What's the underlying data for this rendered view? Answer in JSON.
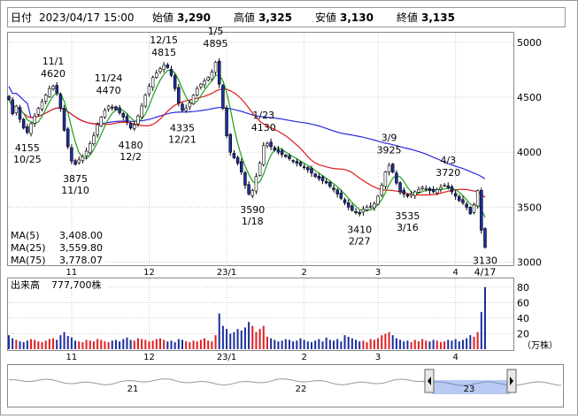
{
  "header": {
    "date_label": "日付",
    "date_value": "2023/04/17 15:00",
    "open_label": "始値",
    "open_value": "3,290",
    "high_label": "高値",
    "high_value": "3,325",
    "low_label": "安値",
    "low_value": "3,130",
    "close_label": "終値",
    "close_value": "3,135"
  },
  "colors": {
    "up": "#ffffff",
    "down": "#1c2fa0",
    "candle_edge": "#000000",
    "ma5": "#1e9e1e",
    "ma25": "#e01818",
    "ma75": "#2a2ae0",
    "high": "#e01818",
    "low": "#1e8e1e",
    "vol_up": "#e02020",
    "vol_down": "#1c2fa0",
    "navigator_fill": "#b0c4f0"
  },
  "chart_data": [
    {
      "type": "candlestick",
      "title": "",
      "y_ticks": [
        3000,
        3500,
        4000,
        4500,
        5000
      ],
      "x_ticks": [
        "11",
        "12",
        "23/1",
        "2",
        "3",
        "4"
      ],
      "ylim": [
        2980,
        5080
      ],
      "legend": [
        {
          "name": "MA(5)",
          "value": "3,408.00",
          "color_key": "ma5"
        },
        {
          "name": "MA(25)",
          "value": "3,559.80",
          "color_key": "ma25"
        },
        {
          "name": "MA(75)",
          "value": "3,778.07",
          "color_key": "ma75"
        }
      ],
      "annotations": [
        {
          "price": "4620",
          "date": "11/1",
          "i": 12,
          "y": 4620,
          "pos": "above"
        },
        {
          "price": "4155",
          "date": "10/25",
          "i": 5,
          "y": 4155,
          "pos": "below"
        },
        {
          "price": "3875",
          "date": "11/10",
          "i": 18,
          "y": 3875,
          "pos": "below"
        },
        {
          "price": "4470",
          "date": "11/24",
          "i": 27,
          "y": 4470,
          "pos": "above"
        },
        {
          "price": "4180",
          "date": "12/2",
          "i": 33,
          "y": 4180,
          "pos": "below"
        },
        {
          "price": "4815",
          "date": "12/15",
          "i": 42,
          "y": 4815,
          "pos": "above"
        },
        {
          "price": "4335",
          "date": "12/21",
          "i": 47,
          "y": 4335,
          "pos": "below"
        },
        {
          "price": "4895",
          "date": "1/5",
          "i": 56,
          "y": 4895,
          "pos": "above"
        },
        {
          "price": "4130",
          "date": "1/23",
          "i": 69,
          "y": 4130,
          "pos": "above"
        },
        {
          "price": "3590",
          "date": "1/18",
          "i": 66,
          "y": 3590,
          "pos": "below"
        },
        {
          "price": "3410",
          "date": "2/27",
          "i": 95,
          "y": 3410,
          "pos": "below"
        },
        {
          "price": "3925",
          "date": "3/9",
          "i": 103,
          "y": 3925,
          "pos": "above"
        },
        {
          "price": "3535",
          "date": "3/16",
          "i": 108,
          "y": 3535,
          "pos": "below"
        },
        {
          "price": "3720",
          "date": "4/3",
          "i": 119,
          "y": 3720,
          "pos": "above"
        },
        {
          "price": "3130",
          "date": "4/17",
          "i": 129,
          "y": 3130,
          "pos": "below"
        }
      ],
      "closes": [
        4480,
        4350,
        4420,
        4300,
        4220,
        4180,
        4260,
        4330,
        4400,
        4460,
        4520,
        4580,
        4600,
        4540,
        4400,
        4200,
        4050,
        3920,
        3890,
        3930,
        3960,
        4010,
        4080,
        4150,
        4250,
        4320,
        4380,
        4420,
        4410,
        4390,
        4360,
        4320,
        4280,
        4220,
        4250,
        4330,
        4420,
        4520,
        4600,
        4680,
        4720,
        4760,
        4790,
        4770,
        4700,
        4580,
        4450,
        4380,
        4400,
        4450,
        4520,
        4580,
        4620,
        4650,
        4680,
        4730,
        4820,
        4620,
        4400,
        4150,
        4000,
        3950,
        3900,
        3820,
        3700,
        3620,
        3650,
        3780,
        3900,
        4060,
        4080,
        4050,
        4020,
        4000,
        3980,
        3960,
        3940,
        3920,
        3900,
        3880,
        3860,
        3840,
        3810,
        3780,
        3760,
        3740,
        3720,
        3690,
        3660,
        3620,
        3580,
        3540,
        3500,
        3470,
        3450,
        3440,
        3480,
        3500,
        3510,
        3530,
        3600,
        3700,
        3820,
        3880,
        3820,
        3720,
        3640,
        3620,
        3600,
        3620,
        3640,
        3660,
        3680,
        3670,
        3650,
        3640,
        3660,
        3680,
        3700,
        3680,
        3640,
        3600,
        3560,
        3540,
        3500,
        3440,
        3520,
        3650,
        3290,
        3135
      ],
      "volumes": [
        18,
        14,
        12,
        10,
        9,
        11,
        13,
        12,
        10,
        9,
        11,
        13,
        14,
        12,
        18,
        22,
        17,
        15,
        11,
        10,
        9,
        12,
        11,
        10,
        13,
        12,
        10,
        9,
        11,
        12,
        10,
        13,
        15,
        12,
        11,
        14,
        13,
        12,
        10,
        11,
        13,
        14,
        12,
        10,
        11,
        9,
        13,
        12,
        10,
        9,
        11,
        10,
        12,
        14,
        11,
        10,
        18,
        46,
        30,
        26,
        20,
        22,
        26,
        24,
        28,
        35,
        30,
        22,
        26,
        30,
        16,
        14,
        12,
        10,
        11,
        13,
        12,
        10,
        11,
        14,
        12,
        10,
        9,
        11,
        13,
        10,
        15,
        12,
        11,
        13,
        10,
        18,
        16,
        14,
        12,
        10,
        11,
        9,
        13,
        12,
        14,
        18,
        20,
        22,
        18,
        14,
        12,
        10,
        11,
        9,
        12,
        10,
        13,
        11,
        10,
        12,
        11,
        9,
        10,
        12,
        11,
        13,
        10,
        12,
        14,
        18,
        16,
        22,
        48,
        80
      ]
    },
    {
      "type": "bar",
      "title": "出来高",
      "value_label": "777,700株",
      "y_ticks": [
        20,
        40,
        60,
        80
      ],
      "unit": "（万株）",
      "x_ticks": [
        "11",
        "12",
        "23/1",
        "2",
        "3",
        "4"
      ]
    },
    {
      "type": "area",
      "labels": [
        "21",
        "22",
        "23"
      ]
    }
  ]
}
